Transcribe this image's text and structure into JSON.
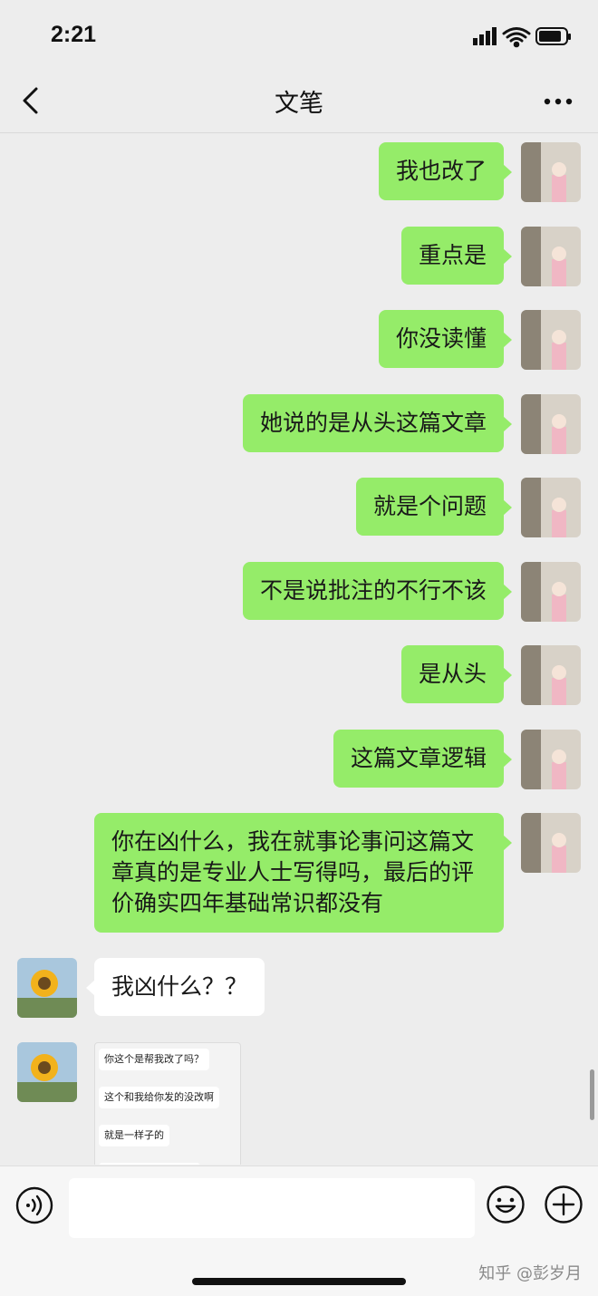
{
  "status": {
    "time": "2:21"
  },
  "nav": {
    "title": "文笔"
  },
  "messages": [
    {
      "text": "我也改了",
      "side": "right"
    },
    {
      "text": "重点是",
      "side": "right"
    },
    {
      "text": "你没读懂",
      "side": "right"
    },
    {
      "text": "她说的是从头这篇文章",
      "side": "right"
    },
    {
      "text": "就是个问题",
      "side": "right"
    },
    {
      "text": "不是说批注的不行不该",
      "side": "right"
    },
    {
      "text": "是从头",
      "side": "right"
    },
    {
      "text": "这篇文章逻辑",
      "side": "right"
    },
    {
      "text": "你在凶什么，我在就事论事问这篇文章真的是专业人士写得吗，最后的评价确实四年基础常识都没有",
      "side": "right"
    },
    {
      "text": "我凶什么？？",
      "side": "left"
    }
  ],
  "image_message": {
    "lines": [
      "你这个是帮我改了吗？",
      "这个和我给你发的没改啊",
      "就是一样子的"
    ]
  },
  "watermark": "知乎 @彭岁月",
  "colors": {
    "my_bubble": "#95ec69",
    "their_bubble": "#ffffff",
    "background": "#ededed"
  }
}
